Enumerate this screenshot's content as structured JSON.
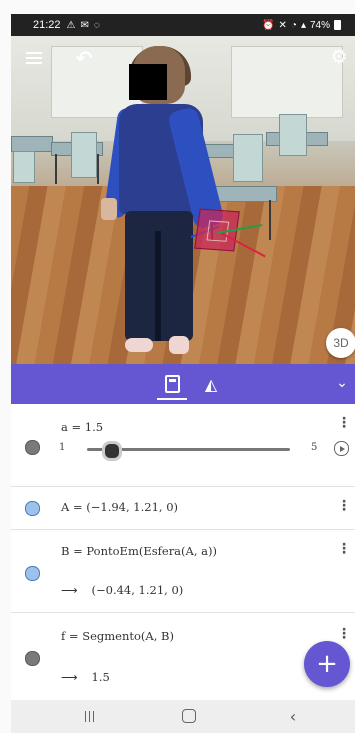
{
  "status_bar": {
    "time": "21:22",
    "left_icons": [
      "warning-icon",
      "mail-icon",
      "whatsapp-icon"
    ],
    "right_icons": [
      "alarm-icon",
      "mute-icon",
      "wifi-icon",
      "signal-icon"
    ],
    "battery": "74%"
  },
  "camera": {
    "view_3d_label": "3D"
  },
  "toolbar": {
    "tabs": [
      "algebra-icon",
      "tools-icon"
    ],
    "active_tab": "algebra-icon",
    "accent_color": "#6557d2"
  },
  "algebra": {
    "slider": {
      "expr": "a = 1.5",
      "min_label": "1",
      "max_label": "5",
      "value": 1.5,
      "min": 1,
      "max": 5
    },
    "point_a": {
      "expr": "A = (−1.94, 1.21, 0)"
    },
    "point_b": {
      "expr": "B = PontoEm(Esfera(A, a))",
      "value": "(−0.44, 1.21, 0)"
    },
    "segment_f": {
      "expr": "f = Segmento(A, B)",
      "value": "1.5"
    },
    "result_arrow": "⟶"
  },
  "fab": {
    "label": "+"
  }
}
